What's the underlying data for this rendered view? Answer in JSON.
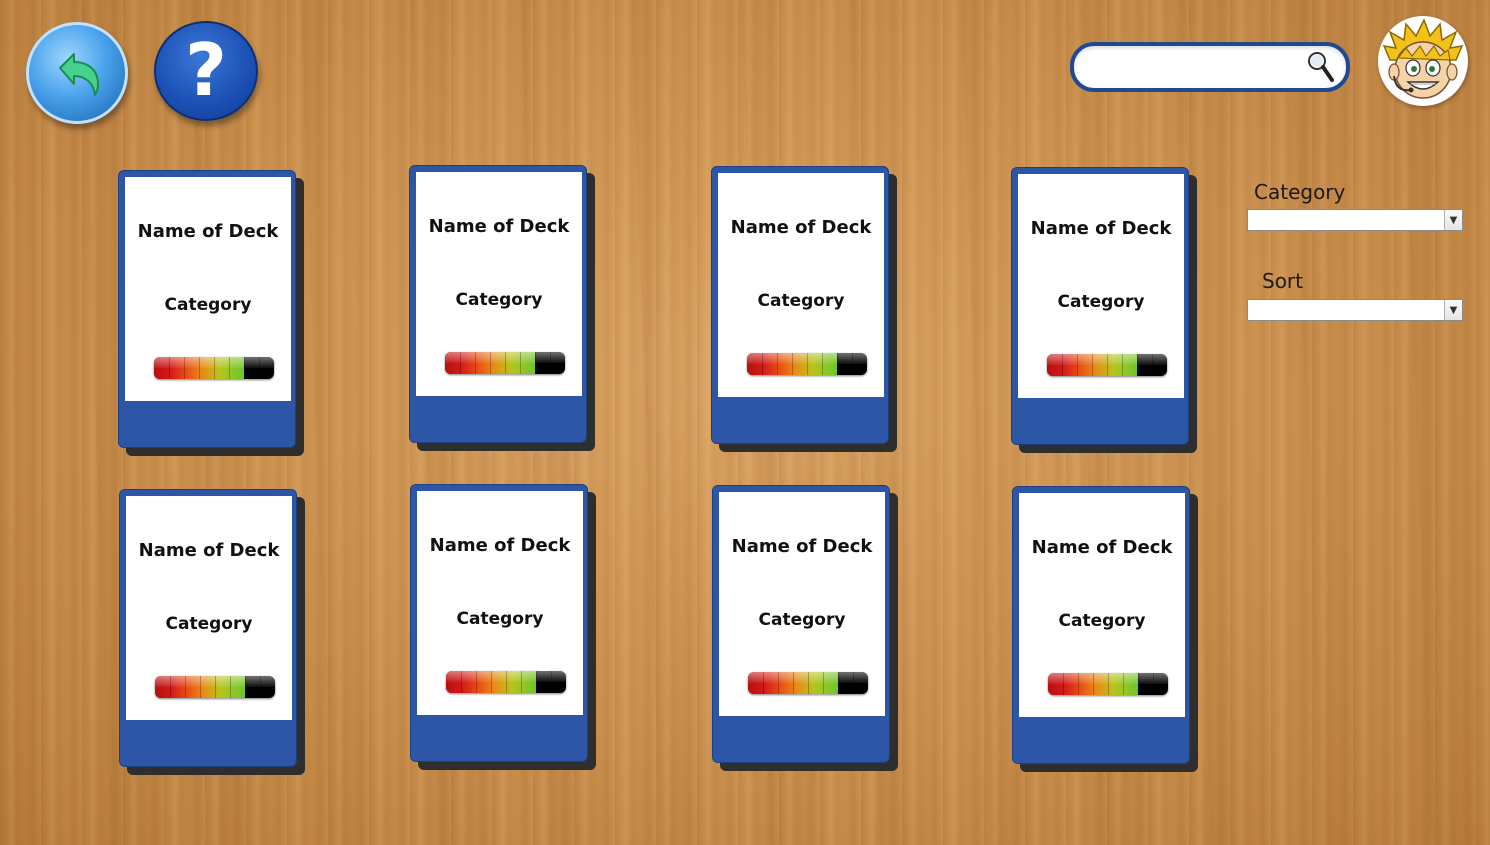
{
  "toolbar": {
    "back_icon": "back-arrow-icon",
    "help_label": "?"
  },
  "search": {
    "value": "",
    "placeholder": "",
    "icon": "search-icon"
  },
  "avatar": {
    "icon": "cartoon-face-avatar"
  },
  "decks": [
    {
      "name": "Name of Deck",
      "category": "Category",
      "level": 0.75
    },
    {
      "name": "Name of Deck",
      "category": "Category",
      "level": 0.75
    },
    {
      "name": "Name of Deck",
      "category": "Category",
      "level": 0.75
    },
    {
      "name": "Name of Deck",
      "category": "Category",
      "level": 0.75
    },
    {
      "name": "Name of Deck",
      "category": "Category",
      "level": 0.75
    },
    {
      "name": "Name of Deck",
      "category": "Category",
      "level": 0.75
    },
    {
      "name": "Name of Deck",
      "category": "Category",
      "level": 0.75
    },
    {
      "name": "Name of Deck",
      "category": "Category",
      "level": 0.75
    }
  ],
  "filters": {
    "category": {
      "label": "Category",
      "value": ""
    },
    "sort": {
      "label": "Sort",
      "value": ""
    }
  },
  "colors": {
    "card_blue": "#2d57a6",
    "help_blue": "#1b4fb3",
    "search_border": "#1f4a93"
  }
}
